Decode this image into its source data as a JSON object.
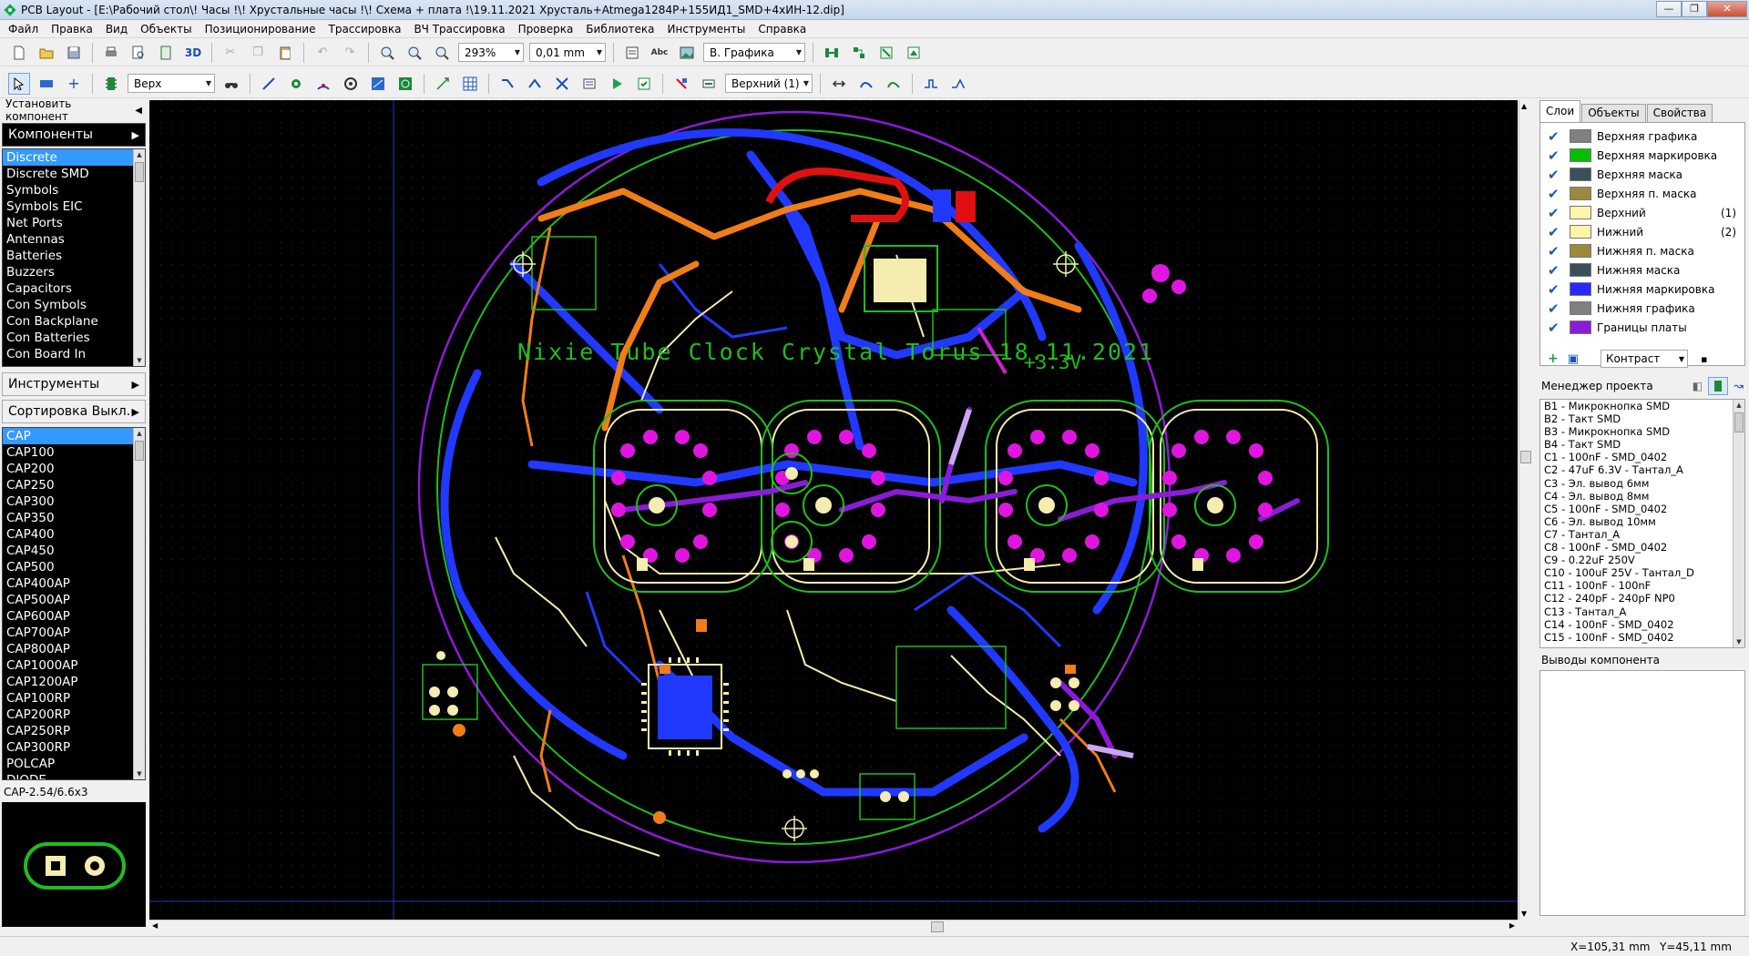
{
  "title": "PCB Layout - [E:\\Рабочий стол\\! Часы !\\! Хрустальные часы !\\! Схема + плата !\\19.11.2021 Хрусталь+Atmega1284P+155ИД1_SMD+4хИН-12.dip]",
  "menu": [
    "Файл",
    "Правка",
    "Вид",
    "Объекты",
    "Позиционирование",
    "Трассировка",
    "ВЧ Трассировка",
    "Проверка",
    "Библиотека",
    "Инструменты",
    "Справка"
  ],
  "toolbar1": {
    "label_3d": "3D",
    "zoom": "293%",
    "grid": "0,01 mm",
    "abc": "Abc",
    "view_mode": "В. Графика"
  },
  "toolbar2": {
    "side": "Верх",
    "layer": "Верхний (1)"
  },
  "left": {
    "install_component": "Установить компонент",
    "components": "Компоненты",
    "categories": [
      "Discrete",
      "Discrete SMD",
      "Symbols",
      "Symbols EIC",
      "Net Ports",
      "Antennas",
      "Batteries",
      "Buzzers",
      "Capacitors",
      "Con Symbols",
      "Con Backplane",
      "Con Batteries",
      "Con Board In"
    ],
    "tools": "Инструменты",
    "sort": "Сортировка Выкл.",
    "parts": [
      "CAP",
      "CAP100",
      "CAP200",
      "CAP250",
      "CAP300",
      "CAP350",
      "CAP400",
      "CAP450",
      "CAP500",
      "CAP400AP",
      "CAP500AP",
      "CAP600AP",
      "CAP700AP",
      "CAP800AP",
      "CAP1000AP",
      "CAP1200AP",
      "CAP100RP",
      "CAP200RP",
      "CAP250RP",
      "CAP300RP",
      "POLCAP",
      "DIODE"
    ],
    "footprint_label": "CAP-2.54/6.6x3"
  },
  "board": {
    "caption": "Nixie Tube Clock Crystal Torus 18.11.2021",
    "voltage": "+3.3V",
    "colors": {
      "top": "#f07d18",
      "bottom": "#2138ff",
      "pad": "#e015e0",
      "silk": "#f5ecb0",
      "outline": "#8a1bd8",
      "green": "#1fbd1f",
      "red": "#e01010"
    }
  },
  "right": {
    "tabs": [
      "Слои",
      "Объекты",
      "Свойства"
    ],
    "layers": [
      {
        "name": "Верхняя графика",
        "color": "#808080",
        "num": ""
      },
      {
        "name": "Верхняя маркировка",
        "color": "#00c000",
        "num": ""
      },
      {
        "name": "Верхняя маска",
        "color": "#3a4f5c",
        "num": ""
      },
      {
        "name": "Верхняя п. маска",
        "color": "#9c8a3a",
        "num": ""
      },
      {
        "name": "Верхний",
        "color": "#fff5a6",
        "num": "(1)"
      },
      {
        "name": "Нижний",
        "color": "#fff5a6",
        "num": "(2)"
      },
      {
        "name": "Нижняя п. маска",
        "color": "#9c8a3a",
        "num": ""
      },
      {
        "name": "Нижняя маска",
        "color": "#3a4f5c",
        "num": ""
      },
      {
        "name": "Нижняя маркировка",
        "color": "#2828ff",
        "num": ""
      },
      {
        "name": "Нижняя графика",
        "color": "#808080",
        "num": ""
      },
      {
        "name": "Границы платы",
        "color": "#8a1bd8",
        "num": ""
      }
    ],
    "contrast": "Контраст",
    "project_manager": "Менеджер проекта",
    "project_items": [
      "B1 - Микрокнопка SMD",
      "B2 - Такт SMD",
      "B3 - Микрокнопка SMD",
      "B4 - Такт SMD",
      "C1 - 100nF - SMD_0402",
      "C2 - 47uF 6.3V - Тантал_А",
      "C3 - Эл. вывод 6мм",
      "C4 - Эл. вывод 8мм",
      "C5 - 100nF - SMD_0402",
      "C6 - Эл. вывод 10мм",
      "C7 - Тантал_А",
      "C8 - 100nF - SMD_0402",
      "C9 - 0.22uF 250V",
      "C10 - 100uF 25V - Тантал_D",
      "C11 - 100nF - 100nF",
      "C12 - 240pF - 240pF NP0",
      "C13 - Тантал_А",
      "C14 - 100nF - SMD_0402",
      "C15 - 100nF - SMD_0402"
    ],
    "pins_title": "Выводы компонента"
  },
  "status": {
    "x": "X=105,31 mm",
    "y": "Y=45,11 mm"
  }
}
